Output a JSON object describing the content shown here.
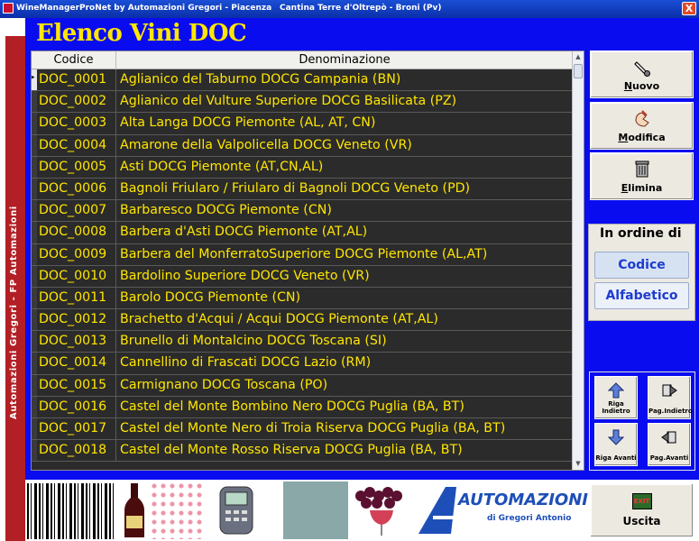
{
  "window": {
    "title": "WineManagerProNet by Automazioni Gregori - Piacenza",
    "company": "Cantina Terre d'Oltrepò - Broni (Pv)",
    "close_glyph": "X"
  },
  "side_brand": "Automazioni Gregori - FP Automazioni",
  "page_title": "Elenco Vini DOC",
  "grid": {
    "columns": [
      "Codice",
      "Denominazione"
    ],
    "rows": [
      {
        "code": "DOC_0001",
        "name": "Aglianico del Taburno DOCG Campania (BN)"
      },
      {
        "code": "DOC_0002",
        "name": "Aglianico del Vulture Superiore DOCG Basilicata (PZ)"
      },
      {
        "code": "DOC_0003",
        "name": "Alta Langa DOCG Piemonte (AL, AT, CN)"
      },
      {
        "code": "DOC_0004",
        "name": "Amarone della Valpolicella DOCG Veneto (VR)"
      },
      {
        "code": "DOC_0005",
        "name": "Asti DOCG Piemonte (AT,CN,AL)"
      },
      {
        "code": "DOC_0006",
        "name": "Bagnoli Friularo / Friularo di Bagnoli DOCG Veneto (PD)"
      },
      {
        "code": "DOC_0007",
        "name": "Barbaresco DOCG Piemonte (CN)"
      },
      {
        "code": "DOC_0008",
        "name": "Barbera d'Asti DOCG Piemonte (AT,AL)"
      },
      {
        "code": "DOC_0009",
        "name": "Barbera del MonferratoSuperiore DOCG Piemonte (AL,AT)"
      },
      {
        "code": "DOC_0010",
        "name": "Bardolino Superiore DOCG Veneto (VR)"
      },
      {
        "code": "DOC_0011",
        "name": "Barolo DOCG Piemonte (CN)"
      },
      {
        "code": "DOC_0012",
        "name": "Brachetto d'Acqui / Acqui DOCG Piemonte (AT,AL)"
      },
      {
        "code": "DOC_0013",
        "name": "Brunello di Montalcino DOCG Toscana (SI)"
      },
      {
        "code": "DOC_0014",
        "name": "Cannellino di Frascati DOCG Lazio (RM)"
      },
      {
        "code": "DOC_0015",
        "name": "Carmignano DOCG Toscana (PO)"
      },
      {
        "code": "DOC_0016",
        "name": "Castel del Monte Bombino Nero DOCG Puglia (BA, BT)"
      },
      {
        "code": "DOC_0017",
        "name": "Castel del Monte Nero di Troia Riserva DOCG Puglia (BA, BT)"
      },
      {
        "code": "DOC_0018",
        "name": "Castel del Monte Rosso Riserva DOCG Puglia (BA, BT)"
      }
    ]
  },
  "actions": {
    "nuovo": {
      "underlined": "N",
      "rest": "uovo",
      "icon": "bottle-opener-icon"
    },
    "modifica": {
      "underlined": "M",
      "rest": "odifica",
      "icon": "edit-hand-icon"
    },
    "elimina": {
      "underlined": "E",
      "rest": "limina",
      "icon": "trash-can-icon"
    }
  },
  "order": {
    "label": "In ordine di",
    "codice": "Codice",
    "alfabetico": "Alfabetico"
  },
  "nav": {
    "riga_indietro": "Riga Indietro",
    "pag_indietro": "Pag.Indietro",
    "riga_avanti": "Riga Avanti",
    "pag_avanti": "Pag.Avanti"
  },
  "footer": {
    "brand_name": "AUTOMAZIONI",
    "brand_sub": "di Gregori Antonio",
    "exit_label": "Uscita",
    "exit_icon_text": "EXIT"
  },
  "colors": {
    "panel_blue": "#0a0cf0",
    "grid_text": "#ffe600",
    "title_yellow": "#ffe600",
    "brand_red": "#b21f24"
  }
}
